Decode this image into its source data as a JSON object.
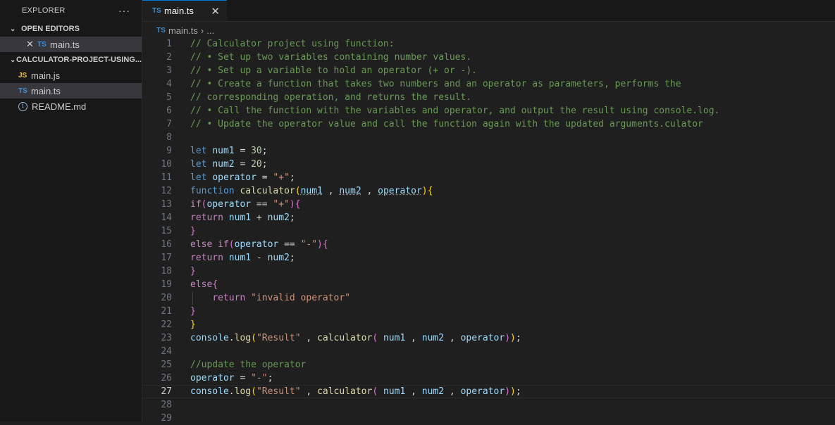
{
  "sidebar": {
    "title": "EXPLORER",
    "more": "···",
    "open_editors": {
      "label": "OPEN EDITORS",
      "items": [
        {
          "badge": "TS",
          "label": "main.ts"
        }
      ]
    },
    "project": {
      "label": "CALCULATOR-PROJECT-USING...",
      "files": [
        {
          "badge": "JS",
          "label": "main.js"
        },
        {
          "badge": "TS",
          "label": "main.ts"
        },
        {
          "badge": "ⓘ",
          "label": "README.md"
        }
      ]
    }
  },
  "tabs": [
    {
      "badge": "TS",
      "label": "main.ts",
      "close": "✕"
    }
  ],
  "breadcrumb": {
    "badge": "TS",
    "file": "main.ts",
    "sep": "›",
    "more": "..."
  },
  "editor": {
    "current_line": 27,
    "line_numbers": [
      "1",
      "2",
      "3",
      "4",
      "5",
      "6",
      "7",
      "8",
      "9",
      "10",
      "11",
      "12",
      "13",
      "14",
      "15",
      "16",
      "17",
      "18",
      "19",
      "20",
      "21",
      "22",
      "23",
      "24",
      "25",
      "26",
      "27",
      "28",
      "29"
    ],
    "comments": {
      "l1": "// Calculator project using function:",
      "l2": "// • Set up two variables containing number values.",
      "l3": "// • Set up a variable to hold an operator (+ or -).",
      "l4": "// • Create a function that takes two numbers and an operator as parameters, performs the",
      "l5": "// corresponding operation, and returns the result.",
      "l6": "// • Call the function with the variables and operator, and output the result using console.log.",
      "l7": "// • Update the operator value and call the function again with the updated arguments.culator",
      "l25": "//update the operator"
    },
    "tokens": {
      "let": "let",
      "num1": "num1",
      "num2": "num2",
      "operator": "operator",
      "v30": "30",
      "v20": "20",
      "plus_str": "\"+\"",
      "minus_str": "\"-\"",
      "function": "function",
      "calculator": "calculator",
      "if": "if",
      "else": "else",
      "return": "return",
      "invalid": "\"invalid operator\"",
      "console": "console",
      "log": "log",
      "result_str": "\"Result\""
    }
  }
}
